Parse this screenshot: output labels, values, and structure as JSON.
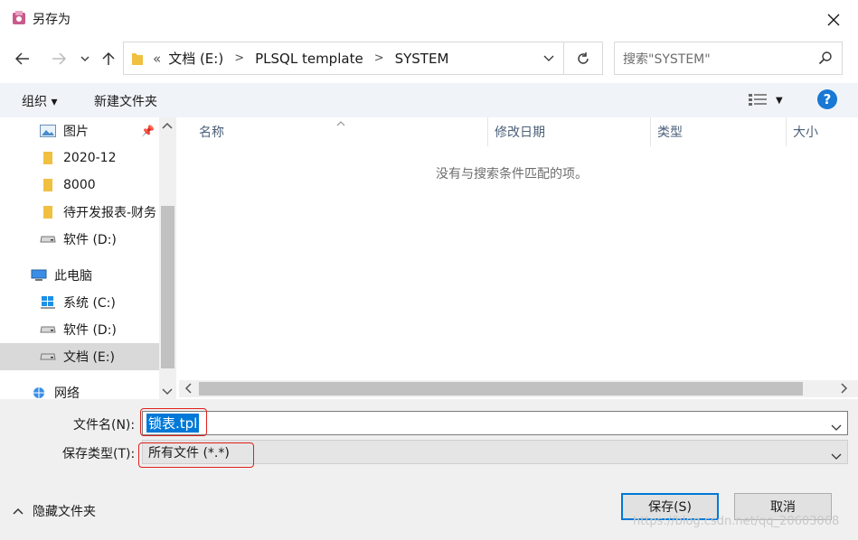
{
  "window": {
    "title": "另存为"
  },
  "address": {
    "overflow": "«",
    "crumbs": [
      "文档 (E:)",
      "PLSQL template",
      "SYSTEM"
    ]
  },
  "search": {
    "placeholder": "搜索\"SYSTEM\""
  },
  "toolbar": {
    "organize": "组织 ▾",
    "new_folder": "新建文件夹"
  },
  "sidebar": {
    "items": [
      {
        "label": "图片",
        "icon": "pictures-icon"
      },
      {
        "label": "2020-12",
        "icon": "folder-icon"
      },
      {
        "label": "8000",
        "icon": "folder-icon"
      },
      {
        "label": "待开发报表-财务",
        "icon": "folder-icon"
      },
      {
        "label": "软件 (D:)",
        "icon": "drive-icon"
      },
      {
        "label": "此电脑",
        "icon": "computer-icon"
      },
      {
        "label": "系统 (C:)",
        "icon": "windows-drive-icon"
      },
      {
        "label": "软件 (D:)",
        "icon": "drive-icon"
      },
      {
        "label": "文档 (E:)",
        "icon": "drive-icon"
      },
      {
        "label": "网络",
        "icon": "network-icon"
      }
    ]
  },
  "columns": [
    "名称",
    "修改日期",
    "类型",
    "大小"
  ],
  "list": {
    "empty_message": "没有与搜索条件匹配的项。"
  },
  "form": {
    "filename_label": "文件名(N):",
    "filename_value": "锁表.tpl",
    "filetype_label": "保存类型(T):",
    "filetype_value": "所有文件 (*.*)"
  },
  "buttons": {
    "save": "保存(S)",
    "cancel": "取消",
    "hide_folders": "隐藏文件夹"
  },
  "watermark": "https://blog.csdn.net/qq_20603068",
  "colors": {
    "accent": "#0078d7",
    "highlight_box": "#e0201b",
    "help": "#1878d4"
  }
}
